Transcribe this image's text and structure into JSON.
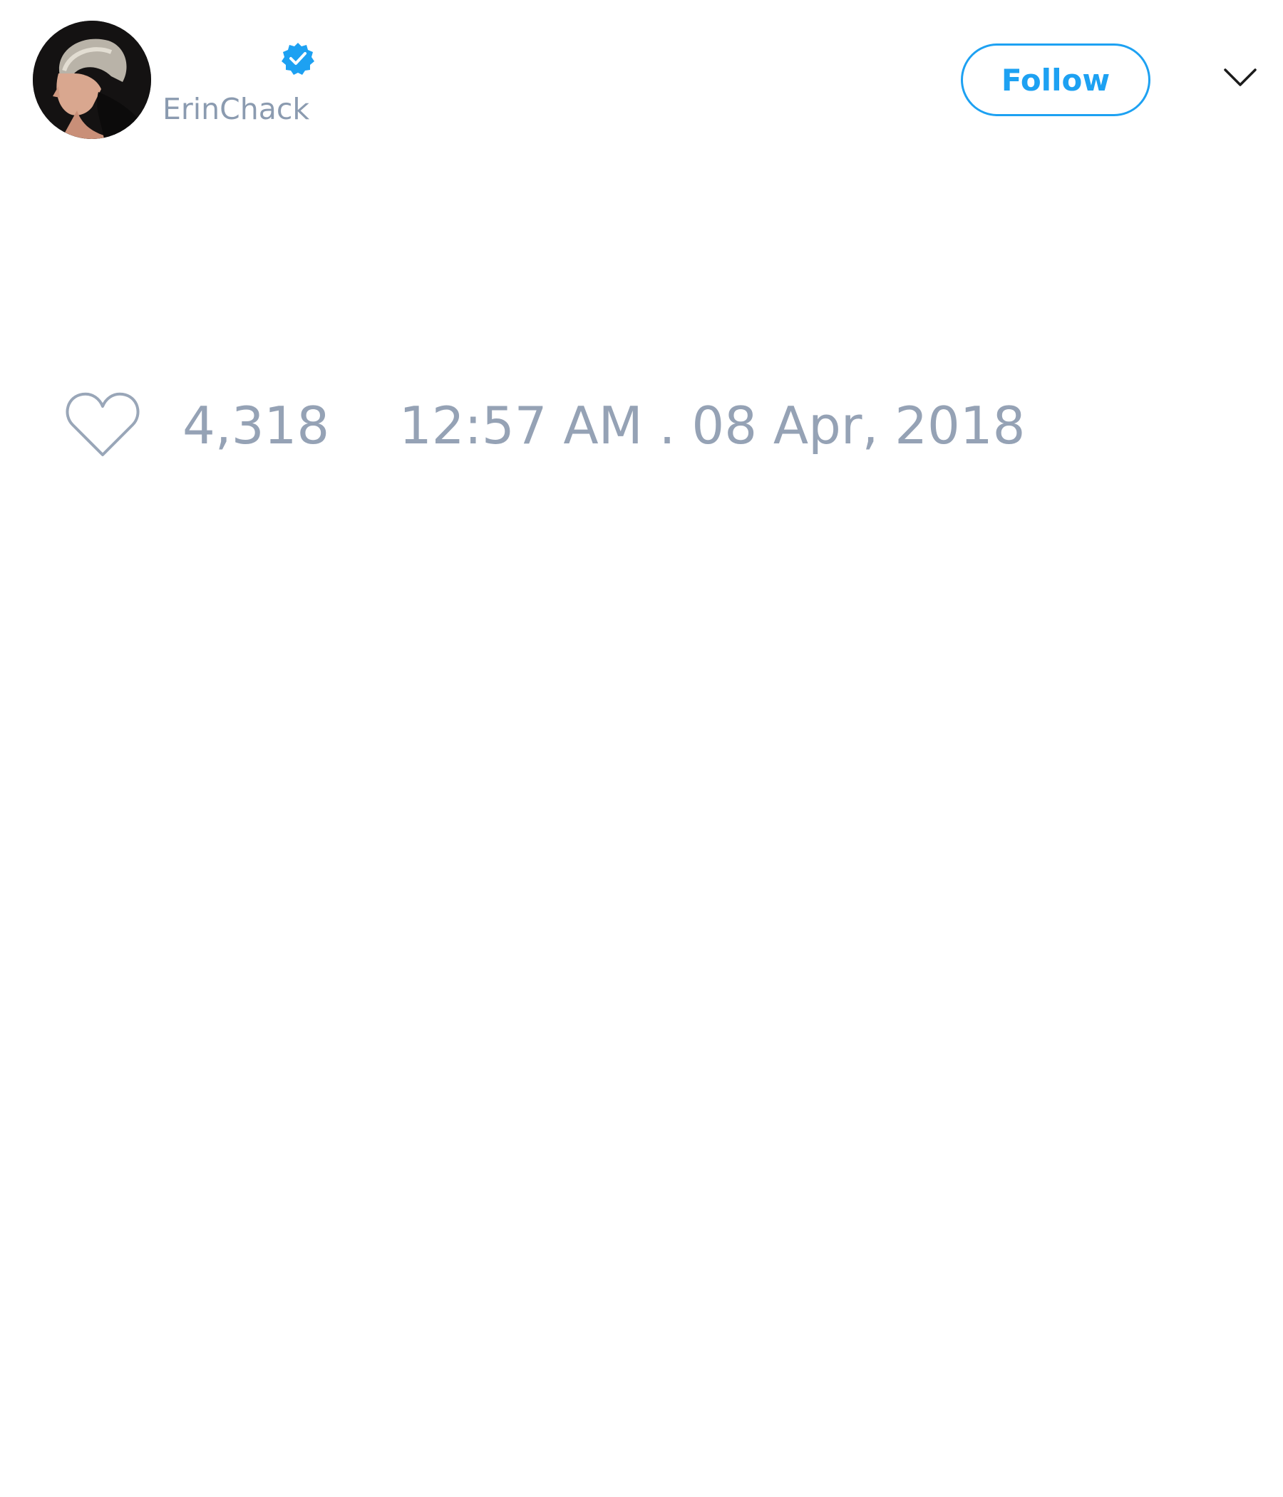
{
  "author": {
    "handle": "ErinChack",
    "verified": true,
    "avatar": "profile-photo"
  },
  "actions": {
    "follow_label": "Follow",
    "menu_icon": "chevron-down-icon"
  },
  "stats": {
    "like_icon": "heart-icon",
    "likes": "4,318",
    "timestamp": "12:57 AM . 08 Apr, 2018"
  },
  "colors": {
    "accent": "#1da1f2",
    "muted_text": "#8b9bb0"
  }
}
